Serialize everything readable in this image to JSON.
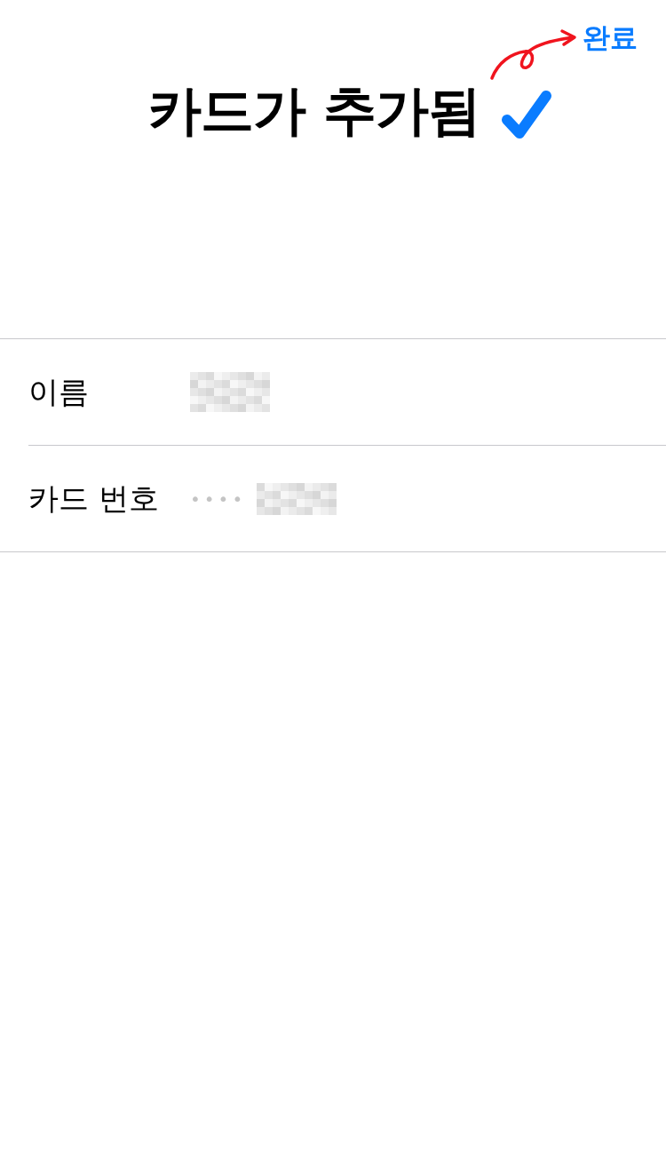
{
  "done_button": "완료",
  "title": "카드가 추가됨",
  "rows": [
    {
      "label": "이름",
      "kind": "name"
    },
    {
      "label": "카드 번호",
      "kind": "card_number",
      "mask": "••••"
    }
  ]
}
